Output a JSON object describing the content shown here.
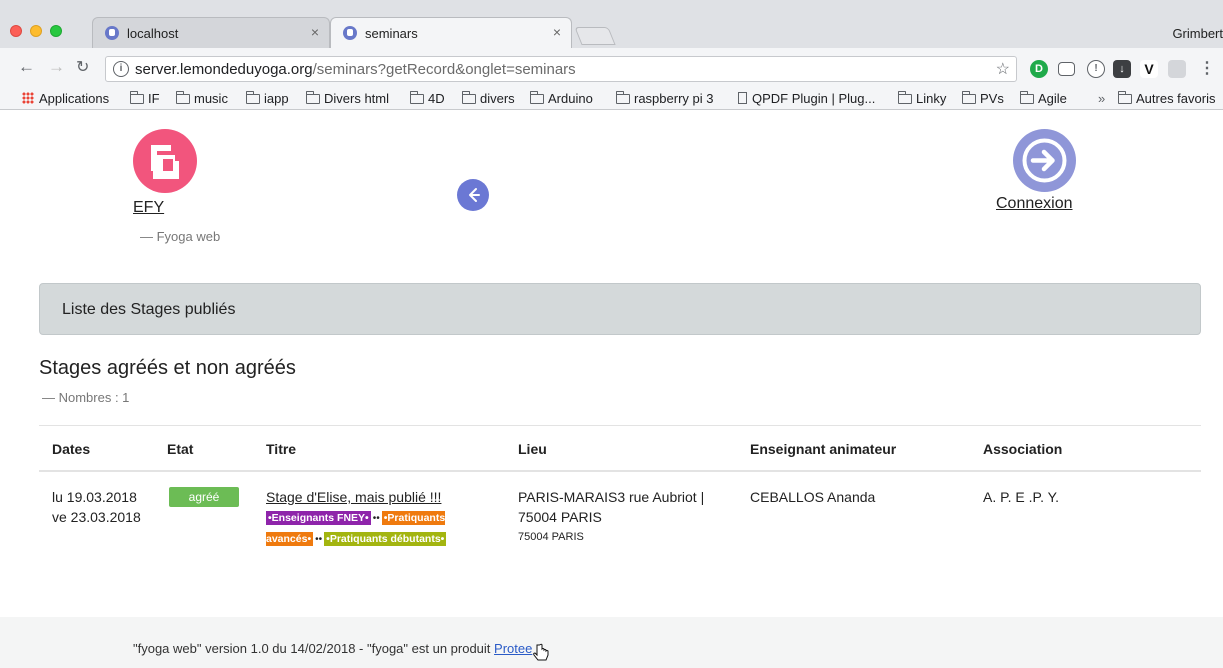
{
  "browser": {
    "tabs": [
      {
        "title": "localhost",
        "close": "×"
      },
      {
        "title": "seminars",
        "close": "×"
      }
    ],
    "profile": "Grimbert",
    "url_host": "server.lemondeduyoga.org",
    "url_path": "/seminars?getRecord&onglet=seminars",
    "bookmarks": [
      "Applications",
      "IF",
      "music",
      "iapp",
      "Divers html",
      "4D",
      "divers",
      "Arduino",
      "raspberry pi 3",
      "QPDF Plugin | Plug...",
      "Linky",
      "PVs",
      "Agile",
      "Autres favoris"
    ],
    "bookmarks_more": "»"
  },
  "header": {
    "brand": "EFY",
    "brand_sub": "— Fyoga web",
    "login": "Connexion",
    "back_icon": "arrow-left-icon"
  },
  "panel": {
    "title": "Liste des Stages publiés"
  },
  "section": {
    "title": "Stages agréés et non agréés",
    "subtitle": "— Nombres : 1"
  },
  "table": {
    "columns": [
      "Dates",
      "Etat",
      "Titre",
      "Lieu",
      "Enseignant animateur",
      "Association"
    ],
    "rows": [
      {
        "date_start": "lu 19.03.2018",
        "date_end": "ve 23.03.2018",
        "status": "agréé",
        "title": "Stage d'Elise, mais publié !!!",
        "tags": [
          "•Enseignants FNEY•",
          "•Pratiquants avancés•",
          "•Pratiquants débutants•"
        ],
        "tag_sep": "••",
        "place_line1": "PARIS-MARAIS3 rue Aubriot |",
        "place_line2": "75004 PARIS",
        "place_small": "75004 PARIS",
        "teacher": "CEBALLOS Ananda",
        "association": "A. P. E .P. Y."
      }
    ]
  },
  "footer": {
    "text": "\"fyoga web\" version 1.0 du 14/02/2018 - \"fyoga\" est un produit ",
    "link": "Protee"
  },
  "colors": {
    "logo_left": "#f2557d",
    "logo_right": "#8f96d8",
    "back_button": "#6b78d4",
    "badge_agree": "#6cbc55",
    "tag_fney": "#8e24aa",
    "tag_avances": "#ef7a0e",
    "tag_debutants": "#a3b510",
    "panel_bg": "#d4d9da"
  }
}
